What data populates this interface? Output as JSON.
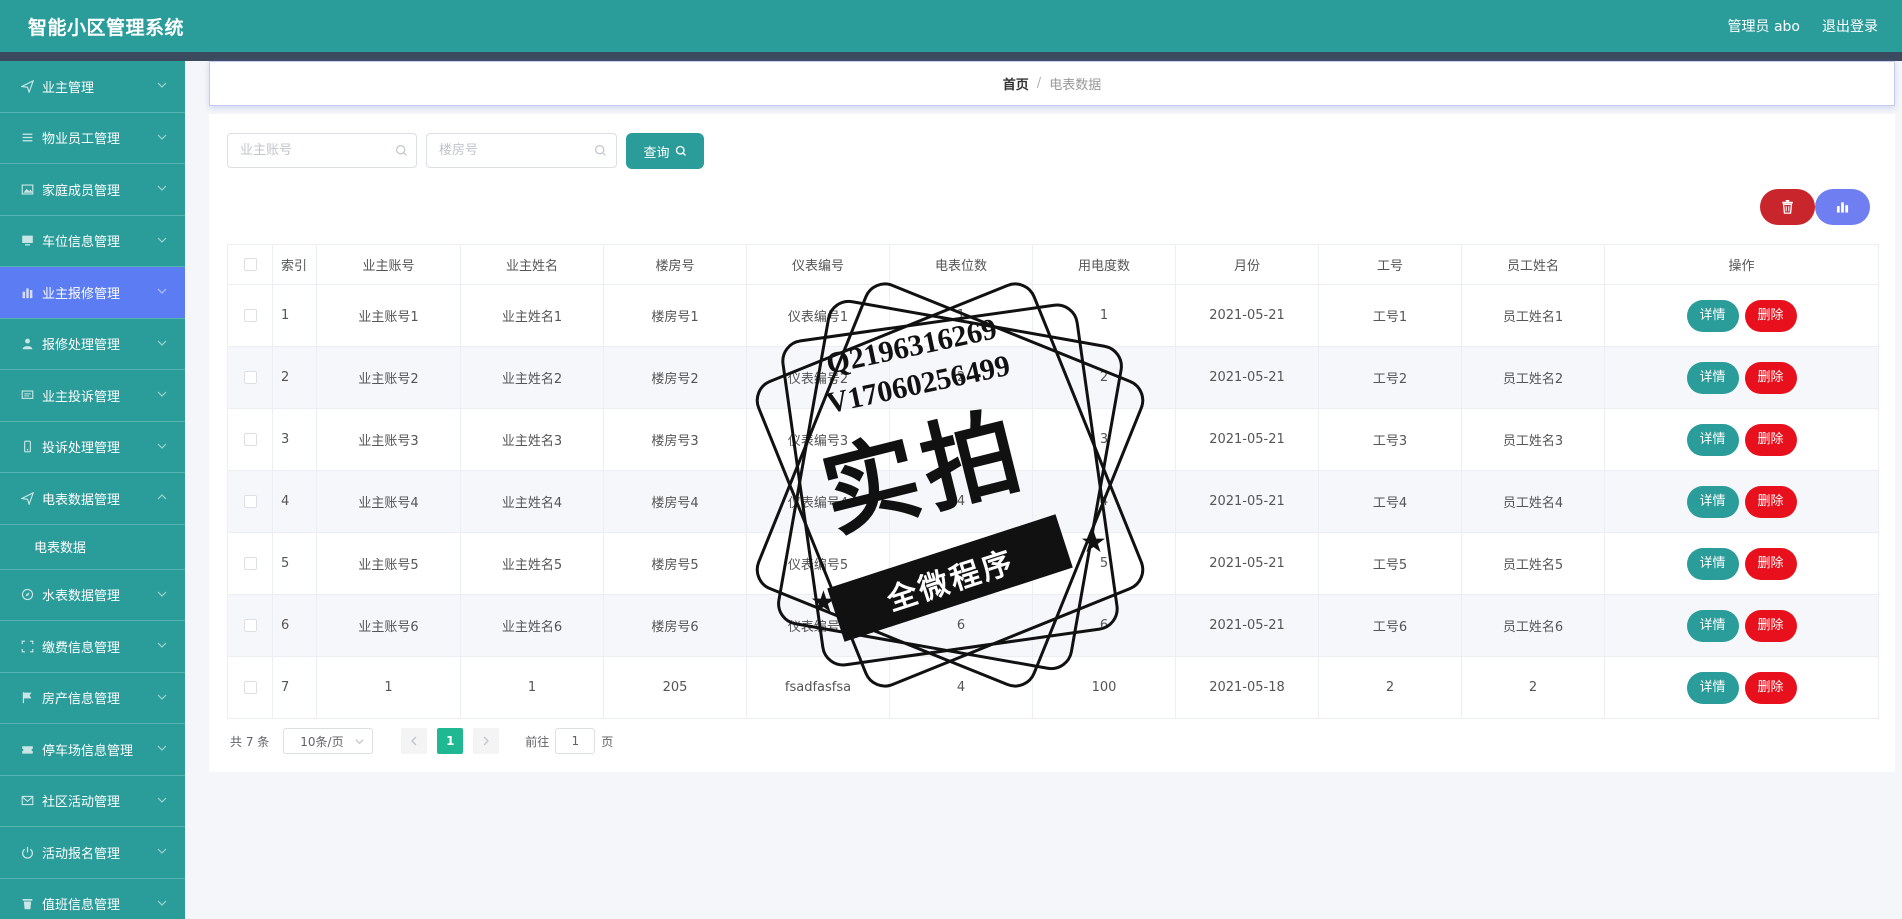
{
  "header": {
    "title": "智能小区管理系统",
    "user_label": "管理员 abo",
    "logout_label": "退出登录"
  },
  "colors": {
    "primary": "#2a9c99",
    "active_menu": "#5b7cf2",
    "danger": "#e8101c",
    "pager_active": "#1fb892"
  },
  "sidebar": {
    "items": [
      {
        "label": "业主管理",
        "icon": "send-icon"
      },
      {
        "label": "物业员工管理",
        "icon": "list-icon"
      },
      {
        "label": "家庭成员管理",
        "icon": "picture-icon"
      },
      {
        "label": "车位信息管理",
        "icon": "monitor-icon"
      },
      {
        "label": "业主报修管理",
        "icon": "bar-chart-icon",
        "active": true
      },
      {
        "label": "报修处理管理",
        "icon": "user-icon"
      },
      {
        "label": "业主投诉管理",
        "icon": "chat-icon"
      },
      {
        "label": "投诉处理管理",
        "icon": "phone-icon"
      },
      {
        "label": "电表数据管理",
        "icon": "send-icon",
        "expanded": true
      },
      {
        "label": "水表数据管理",
        "icon": "compass-icon"
      },
      {
        "label": "缴费信息管理",
        "icon": "fullscreen-icon"
      },
      {
        "label": "房产信息管理",
        "icon": "flag-icon"
      },
      {
        "label": "停车场信息管理",
        "icon": "ticket-icon"
      },
      {
        "label": "社区活动管理",
        "icon": "message-icon"
      },
      {
        "label": "活动报名管理",
        "icon": "power-icon"
      },
      {
        "label": "值班信息管理",
        "icon": "delete-icon"
      }
    ],
    "submenu": {
      "label": "电表数据"
    }
  },
  "breadcrumb": {
    "home": "首页",
    "separator": "/",
    "current": "电表数据"
  },
  "search": {
    "owner_account_placeholder": "业主账号",
    "building_placeholder": "楼房号",
    "query_label": "查询"
  },
  "table": {
    "headers": [
      "索引",
      "业主账号",
      "业主姓名",
      "楼房号",
      "仪表编号",
      "电表位数",
      "用电度数",
      "月份",
      "工号",
      "员工姓名",
      "操作"
    ],
    "rows": [
      {
        "index": "1",
        "account": "业主账号1",
        "name": "业主姓名1",
        "building": "楼房号1",
        "meter": "仪表编号1",
        "digits": "1",
        "usage": "1",
        "month": "2021-05-21",
        "staff_no": "工号1",
        "staff_name": "员工姓名1"
      },
      {
        "index": "2",
        "account": "业主账号2",
        "name": "业主姓名2",
        "building": "楼房号2",
        "meter": "仪表编号2",
        "digits": "2",
        "usage": "2",
        "month": "2021-05-21",
        "staff_no": "工号2",
        "staff_name": "员工姓名2"
      },
      {
        "index": "3",
        "account": "业主账号3",
        "name": "业主姓名3",
        "building": "楼房号3",
        "meter": "仪表编号3",
        "digits": "3",
        "usage": "3",
        "month": "2021-05-21",
        "staff_no": "工号3",
        "staff_name": "员工姓名3"
      },
      {
        "index": "4",
        "account": "业主账号4",
        "name": "业主姓名4",
        "building": "楼房号4",
        "meter": "仪表编号4",
        "digits": "4",
        "usage": "4",
        "month": "2021-05-21",
        "staff_no": "工号4",
        "staff_name": "员工姓名4"
      },
      {
        "index": "5",
        "account": "业主账号5",
        "name": "业主姓名5",
        "building": "楼房号5",
        "meter": "仪表编号5",
        "digits": "5",
        "usage": "5",
        "month": "2021-05-21",
        "staff_no": "工号5",
        "staff_name": "员工姓名5"
      },
      {
        "index": "6",
        "account": "业主账号6",
        "name": "业主姓名6",
        "building": "楼房号6",
        "meter": "仪表编号6",
        "digits": "6",
        "usage": "6",
        "month": "2021-05-21",
        "staff_no": "工号6",
        "staff_name": "员工姓名6"
      },
      {
        "index": "7",
        "account": "1",
        "name": "1",
        "building": "205",
        "meter": "fsadfasfsa",
        "digits": "4",
        "usage": "100",
        "month": "2021-05-18",
        "staff_no": "2",
        "staff_name": "2"
      }
    ],
    "detail_label": "详情",
    "delete_label": "删除"
  },
  "pagination": {
    "total_label": "共 7 条",
    "page_size_label": "10条/页",
    "current_page": "1",
    "goto_label": "前往",
    "goto_value": "1",
    "page_suffix": "页"
  },
  "watermark": {
    "line1": "Q2196316269",
    "line2": "V17060256499",
    "big_text": "实拍",
    "banner_text": "全微程序"
  }
}
